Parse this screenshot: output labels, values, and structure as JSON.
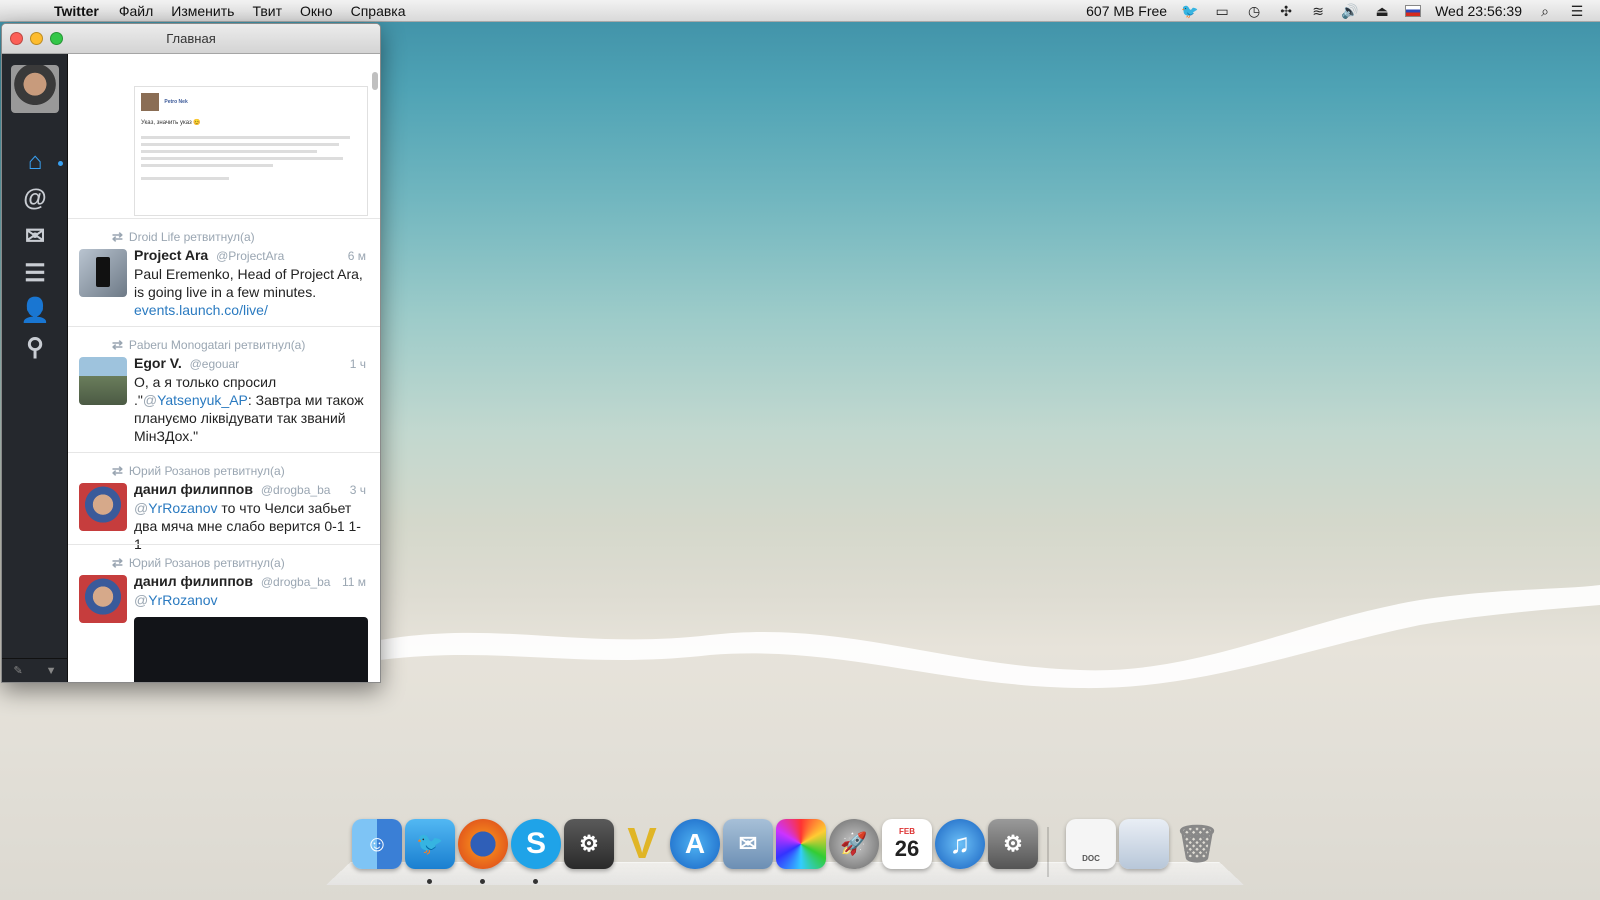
{
  "menubar": {
    "app": "Twitter",
    "items": [
      "Файл",
      "Изменить",
      "Твит",
      "Окно",
      "Справка"
    ],
    "memory": "607 MB Free",
    "clock": "Wed 23:56:39"
  },
  "window": {
    "title": "Главная",
    "nav": [
      "home-icon",
      "mentions-icon",
      "messages-icon",
      "lists-icon",
      "profile-icon",
      "search-icon"
    ]
  },
  "preview": {
    "name": "Petro Nek",
    "text": "Указ, значить указ 😊"
  },
  "tweets": [
    {
      "retweeted_by": "Droid Life ретвитнул(а)",
      "name": "Project Ara",
      "handle": "@ProjectAra",
      "time": "6 м",
      "text": "Paul Eremenko, Head of Project Ara, is going live in a few minutes.",
      "link": "events.launch.co/live/"
    },
    {
      "retweeted_by": "Paberu Monogatari ретвитнул(а)",
      "name": "Egor V.",
      "handle": "@egouar",
      "time": "1 ч",
      "text_before": "О, а я только спросил .\"",
      "mention": "Yatsenyuk_AP",
      "text_after": ": Завтра ми також плануємо ліквідувати так званий МінЗДох.\""
    },
    {
      "retweeted_by": "Юрий Розанов ретвитнул(а)",
      "name": "данил филиппов",
      "handle": "@drogba_ba",
      "time": "3 ч",
      "mention": "YrRozanov",
      "text": " то что Челси забьет два мяча мне слабо верится 0-1 1-1"
    },
    {
      "retweeted_by": "Юрий Розанов ретвитнул(а)",
      "name": "данил филиппов",
      "handle": "@drogba_ba",
      "time": "11 м",
      "mention": "YrRozanov"
    }
  ],
  "dock": {
    "calendar_month": "FEB",
    "calendar_day": "26",
    "doc_label": "DOC"
  }
}
